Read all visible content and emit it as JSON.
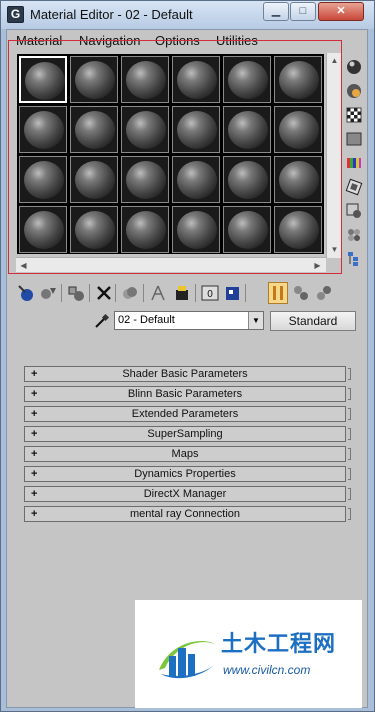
{
  "window": {
    "title": "Material Editor - 02 - Default",
    "app_icon_letter": "G",
    "minimize_glyph": "▁",
    "maximize_glyph": "□",
    "close_glyph": "✕"
  },
  "menu": [
    {
      "label": "Material"
    },
    {
      "label": "Navigation"
    },
    {
      "label": "Options"
    },
    {
      "label": "Utilities"
    }
  ],
  "sample_slots": {
    "rows": 4,
    "cols": 6,
    "active_index": 0
  },
  "side_toolbar": [
    {
      "icon": "sample-type-sphere-icon",
      "active": false
    },
    {
      "icon": "backlight-icon",
      "active": true
    },
    {
      "icon": "background-checker-icon",
      "active": false
    },
    {
      "icon": "sample-uv-tiling-icon",
      "active": false
    },
    {
      "icon": "video-color-check-icon",
      "active": false
    },
    {
      "icon": "make-preview-icon",
      "active": false
    },
    {
      "icon": "options-icon",
      "active": false
    },
    {
      "icon": "select-by-material-icon",
      "active": false
    },
    {
      "icon": "material-map-navigator-icon",
      "active": false
    }
  ],
  "bottom_toolbar": [
    {
      "icon": "get-material-icon",
      "active": false
    },
    {
      "icon": "put-material-to-scene-icon",
      "active": false
    },
    {
      "icon": "assign-material-to-selection-icon",
      "active": false
    },
    {
      "icon": "reset-map-icon",
      "active": false
    },
    {
      "icon": "make-material-copy-icon",
      "active": false
    },
    {
      "icon": "make-unique-icon",
      "active": false
    },
    {
      "icon": "put-to-library-icon",
      "active": false
    },
    {
      "icon": "material-id-channel-icon",
      "active": false
    },
    {
      "icon": "show-map-in-viewport-icon",
      "active": false
    },
    {
      "icon": "show-end-result-icon",
      "active": true
    },
    {
      "icon": "go-to-parent-icon",
      "active": false
    },
    {
      "icon": "go-forward-to-sibling-icon",
      "active": false
    }
  ],
  "material": {
    "name": "02 - Default",
    "type_button": "Standard"
  },
  "rollouts": [
    {
      "sign": "+",
      "label": "Shader Basic Parameters"
    },
    {
      "sign": "+",
      "label": "Blinn Basic Parameters"
    },
    {
      "sign": "+",
      "label": "Extended Parameters"
    },
    {
      "sign": "+",
      "label": "SuperSampling"
    },
    {
      "sign": "+",
      "label": "Maps"
    },
    {
      "sign": "+",
      "label": "Dynamics Properties"
    },
    {
      "sign": "+",
      "label": "DirectX Manager"
    },
    {
      "sign": "+",
      "label": "mental ray Connection"
    }
  ],
  "watermark": {
    "text_cn": "土木工程网",
    "url": "www.civilcn.com"
  },
  "colors": {
    "highlight_frame": "#d42c3a",
    "active_tool_fill": "#f5d889",
    "watermark_blue": "#1d6fc2"
  }
}
